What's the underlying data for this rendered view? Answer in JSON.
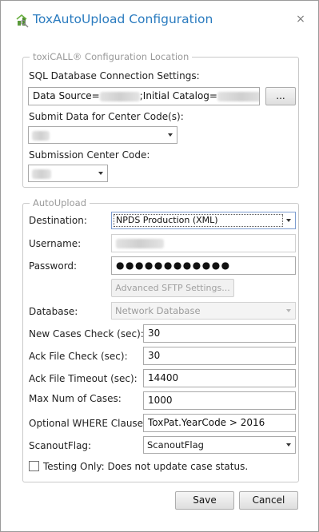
{
  "window": {
    "title": "ToxAutoUpload Configuration",
    "close_glyph": "×",
    "icon": "app-icon"
  },
  "location_group": {
    "legend": "toxiCALL® Configuration Location",
    "sql_label": "SQL Database Connection Settings:",
    "connection": {
      "prefix": "Data Source=",
      "middle": ";Initial Catalog=",
      "suffix": ";"
    },
    "browse_label": "...",
    "center_codes_label": "Submit Data for Center Code(s):",
    "submission_center_label": "Submission Center Code:"
  },
  "autoupload_group": {
    "legend": "AutoUpload",
    "destination": {
      "label": "Destination:",
      "value": "NPDS Production (XML)"
    },
    "username": {
      "label": "Username:"
    },
    "password": {
      "label": "Password:",
      "value": "●●●●●●●●●●●●"
    },
    "advanced_sftp_label": "Advanced SFTP Settings...",
    "database": {
      "label": "Database:",
      "value": "Network Database"
    },
    "new_cases_check": {
      "label": "New Cases Check (sec):",
      "value": "30"
    },
    "ack_file_check": {
      "label": "Ack File Check (sec):",
      "value": "30"
    },
    "ack_file_timeout": {
      "label": "Ack File Timeout (sec):",
      "value": "14400"
    },
    "max_num_cases": {
      "label": "Max Num of Cases:",
      "value": "1000"
    },
    "where_clause": {
      "label": "Optional WHERE Clause:",
      "value": "ToxPat.YearCode > 2016"
    },
    "scanout_flag": {
      "label": "ScanoutFlag:",
      "value": "ScanoutFlag"
    },
    "testing_only": {
      "label": "Testing Only: Does not update case status.",
      "checked": false
    }
  },
  "footer": {
    "save_label": "Save",
    "cancel_label": "Cancel"
  }
}
